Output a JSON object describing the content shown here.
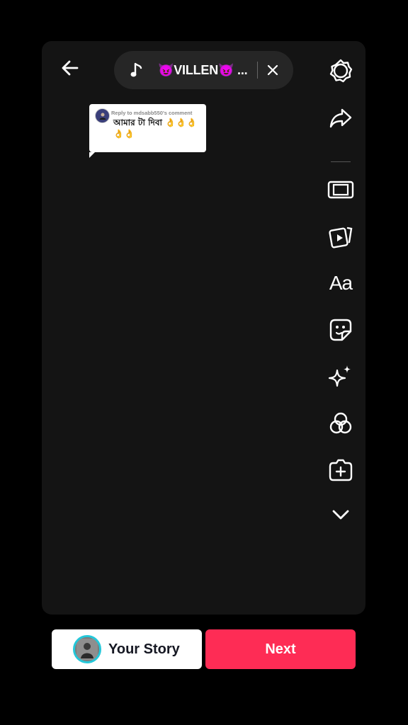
{
  "music": {
    "title": "😈VILLEN😈 ...",
    "note_icon": "music-note-icon",
    "close_icon": "close-icon"
  },
  "reply_sticker": {
    "header": "Reply to mdsabb550's comment",
    "text": "আমার টা দিবা 👌👌👌👌👌"
  },
  "toolbar": {
    "items": [
      "settings-icon",
      "share-icon",
      "aspect-ratio-icon",
      "templates-icon",
      "text-icon",
      "sticker-icon",
      "effects-icon",
      "filters-icon",
      "add-clip-icon",
      "chevron-down-icon"
    ],
    "text_label": "Aa"
  },
  "actions": {
    "story_label": "Your Story",
    "next_label": "Next"
  },
  "colors": {
    "next": "#fe2c55",
    "story_ring": "#25c7d9"
  }
}
